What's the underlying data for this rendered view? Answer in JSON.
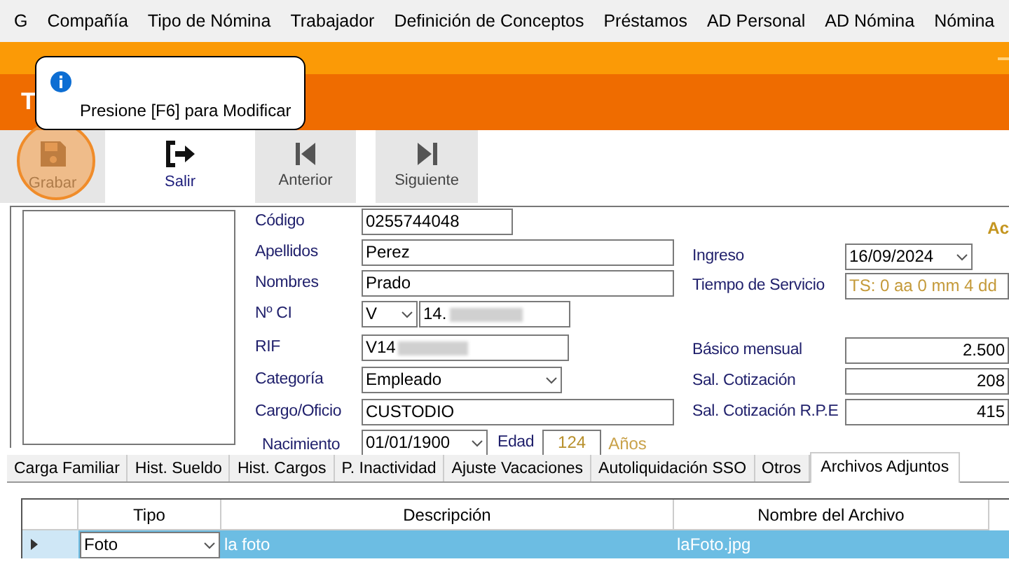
{
  "menu": [
    {
      "label": "G"
    },
    {
      "label": "Compañía"
    },
    {
      "label": "Tipo de Nómina"
    },
    {
      "label": "Trabajador"
    },
    {
      "label": "Definición de Conceptos"
    },
    {
      "label": "Préstamos"
    },
    {
      "label": "AD Personal"
    },
    {
      "label": "AD Nómina"
    },
    {
      "label": "Nómina"
    }
  ],
  "window": {
    "title": "T"
  },
  "tooltip": {
    "text": "Presione [F6] para Modificar"
  },
  "toolbar": [
    {
      "label": "Grabar",
      "kind": "save",
      "highlighted": true,
      "hovered": false
    },
    {
      "label": "Salir",
      "kind": "exit",
      "highlighted": false,
      "hovered": true
    },
    {
      "label": "Anterior",
      "kind": "previous",
      "highlighted": false,
      "hovered": false
    },
    {
      "label": "Siguiente",
      "kind": "next",
      "highlighted": false,
      "hovered": false
    }
  ],
  "employee": {
    "codigo": {
      "label": "Código",
      "value": "0255744048"
    },
    "apellidos": {
      "label": "Apellidos",
      "value": "Perez"
    },
    "nombres": {
      "label": "Nombres",
      "value": "Prado"
    },
    "ci": {
      "label": "Nº CI",
      "type": "V",
      "number": "14.",
      "redacted": true
    },
    "rif": {
      "label": "RIF",
      "value": "V14",
      "redacted": true
    },
    "categoria": {
      "label": "Categoría",
      "value": "Empleado"
    },
    "cargo": {
      "label": "Cargo/Oficio",
      "value": "CUSTODIO"
    },
    "nacimiento": {
      "label": "Nacimiento",
      "value": "01/01/1900"
    },
    "edad": {
      "label": "Edad",
      "value": "124",
      "unit": "Años"
    },
    "status": "Ac",
    "ingreso": {
      "label": "Ingreso",
      "value": "16/09/2024"
    },
    "tiempo_servicio": {
      "label": "Tiempo de Servicio",
      "value": "TS: 0 aa 0 mm 4 dd"
    },
    "salaries": [
      {
        "label": "Básico mensual",
        "value": "2.500"
      },
      {
        "label": "Sal. Cotización",
        "value": "208"
      },
      {
        "label": "Sal. Cotización R.P.E",
        "value": "415"
      }
    ]
  },
  "tabs": [
    {
      "label": "Carga Familiar",
      "selected": false
    },
    {
      "label": "Hist. Sueldo",
      "selected": false
    },
    {
      "label": "Hist. Cargos",
      "selected": false
    },
    {
      "label": "P.  Inactividad",
      "selected": false
    },
    {
      "label": "Ajuste Vacaciones",
      "selected": false
    },
    {
      "label": "Autoliquidación SSO",
      "selected": false
    },
    {
      "label": "Otros",
      "selected": false
    },
    {
      "label": "Archivos Adjuntos",
      "selected": true
    }
  ],
  "grid": {
    "columns": [
      "Tipo",
      "Descripción",
      "Nombre del Archivo"
    ],
    "rows": [
      {
        "tipo": "Foto",
        "descripcion": "la foto",
        "archivo": "laFoto.jpg",
        "selected": true
      }
    ]
  }
}
